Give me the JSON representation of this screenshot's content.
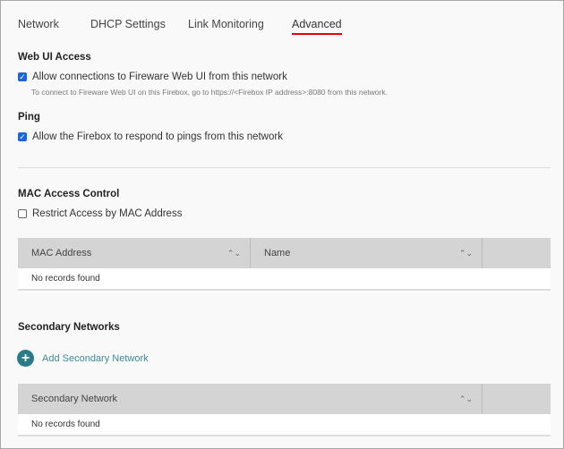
{
  "tabs": [
    {
      "label": "Network"
    },
    {
      "label": "DHCP Settings"
    },
    {
      "label": "Link Monitoring"
    },
    {
      "label": "Advanced",
      "active": true
    }
  ],
  "web_ui": {
    "heading": "Web UI Access",
    "checkbox_label": "Allow connections to Fireware Web UI from this network",
    "checked": true,
    "hint": "To connect to Fireware Web UI on this Firebox, go to https://<Firebox IP address>:8080 from this network."
  },
  "ping": {
    "heading": "Ping",
    "checkbox_label": "Allow the Firebox to respond to pings from this network",
    "checked": true
  },
  "mac": {
    "heading": "MAC Access Control",
    "checkbox_label": "Restrict Access by MAC Address",
    "checked": false,
    "columns": [
      "MAC Address",
      "Name"
    ],
    "empty": "No records found"
  },
  "secondary": {
    "heading": "Secondary Networks",
    "add_label": "Add Secondary Network",
    "columns": [
      "Secondary Network"
    ],
    "empty": "No records found"
  },
  "colors": {
    "accent": "#e00000",
    "add": "#2b7a87",
    "checkbox": "#1a66d6"
  }
}
